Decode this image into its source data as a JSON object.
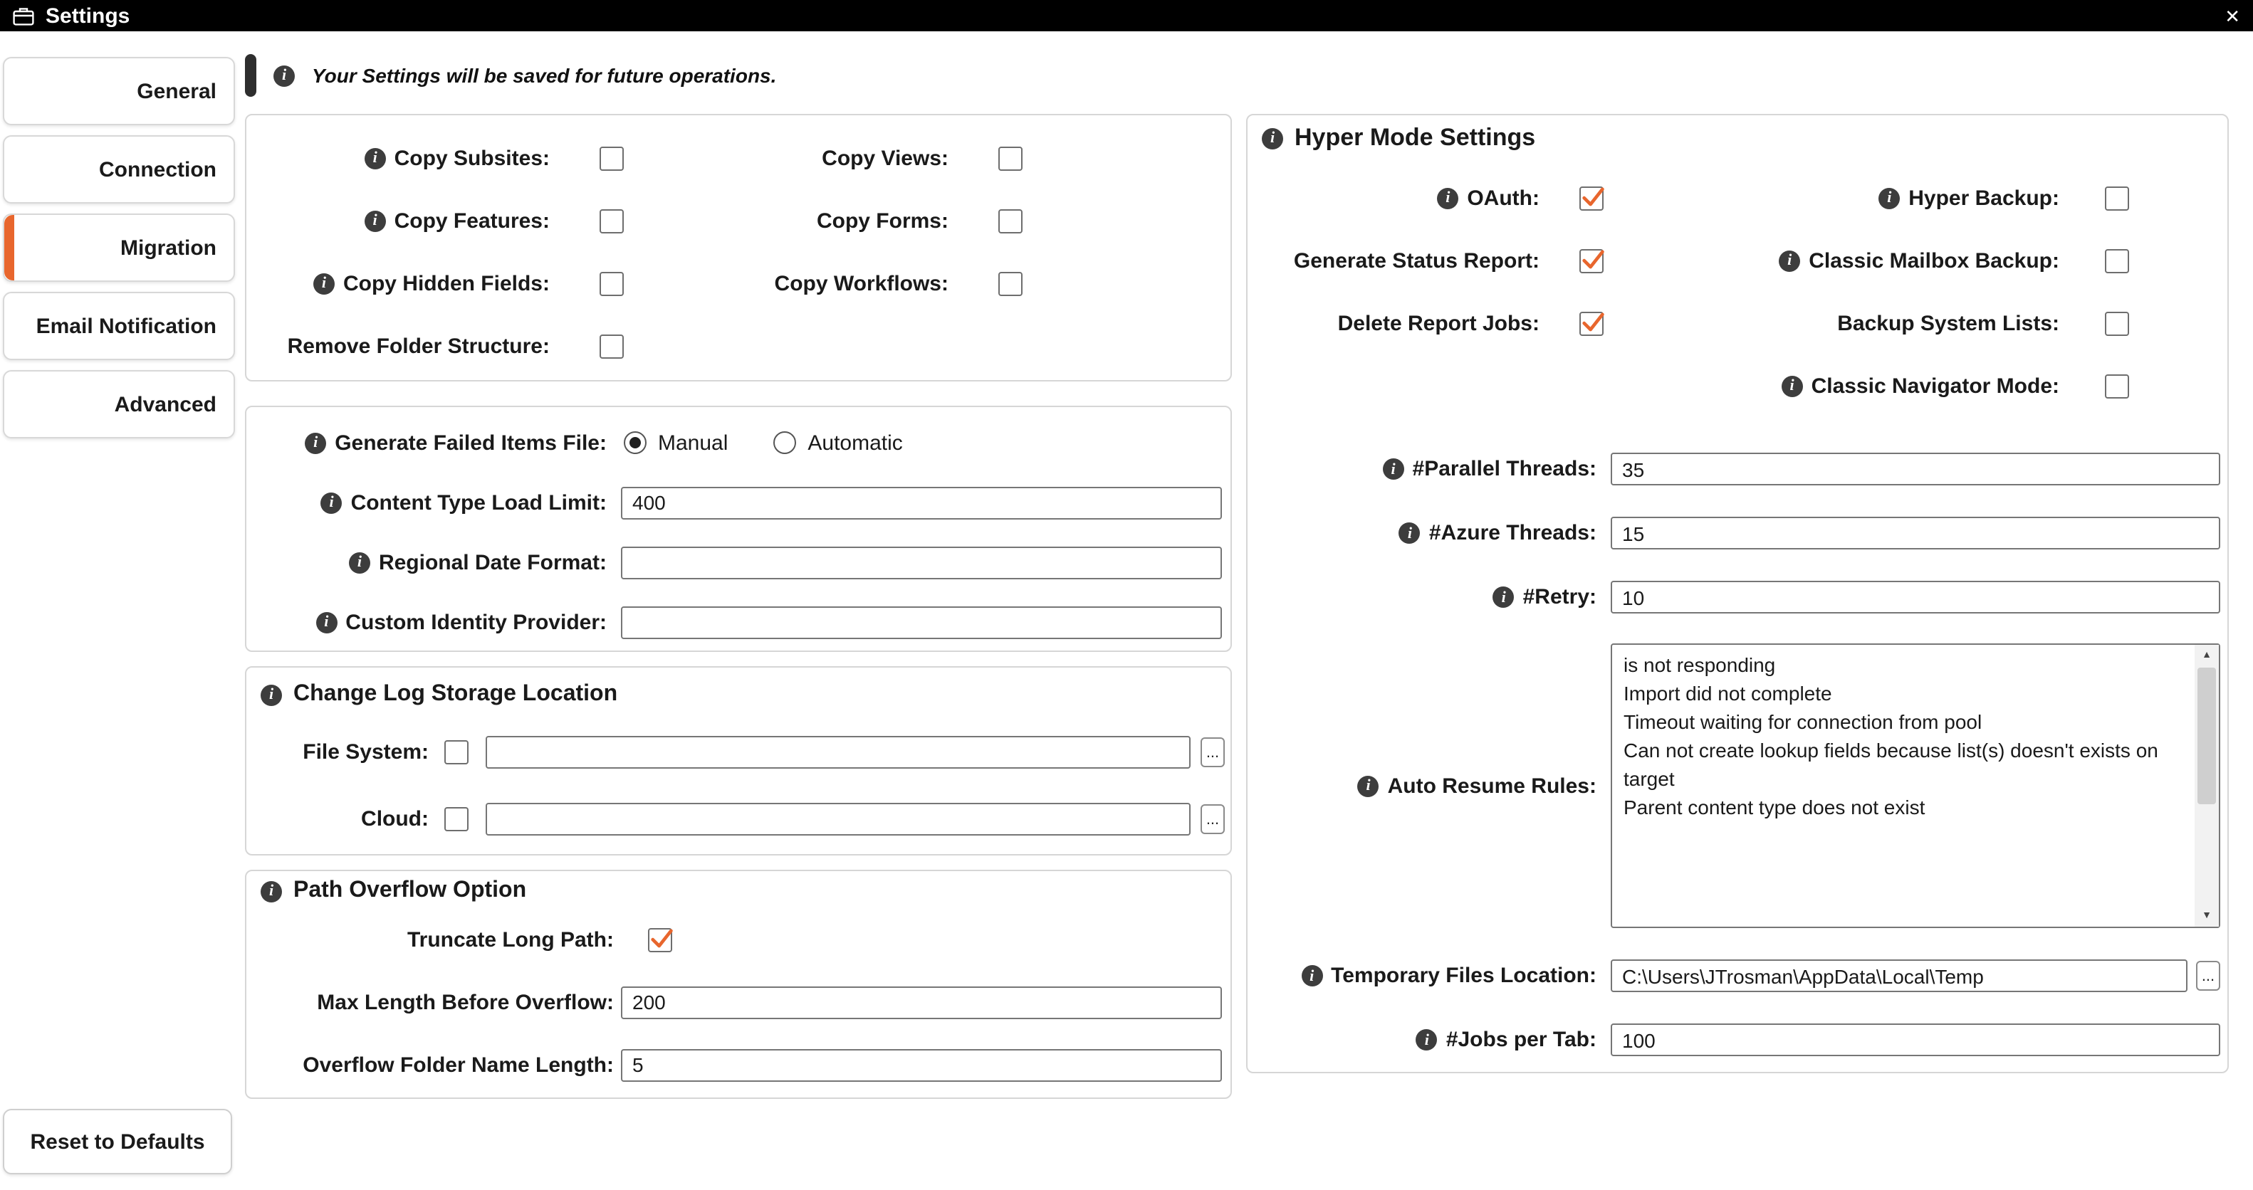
{
  "window": {
    "title": "Settings",
    "close_glyph": "✕"
  },
  "icons": {
    "info": "i",
    "browse": "...",
    "scroll_up": "▲",
    "scroll_down": "▼"
  },
  "colors": {
    "accent": "#E8662D",
    "titlebar": "#000000"
  },
  "sidebar": {
    "tabs": [
      {
        "label": "General",
        "active": false
      },
      {
        "label": "Connection",
        "active": false
      },
      {
        "label": "Migration",
        "active": true
      },
      {
        "label": "Email Notification",
        "active": false
      },
      {
        "label": "Advanced",
        "active": false
      }
    ],
    "reset_button": "Reset to Defaults"
  },
  "banner": {
    "text": "Your Settings will be saved for future operations."
  },
  "copy_options": {
    "items": [
      {
        "label": "Copy Subsites:",
        "info": true,
        "checked": false
      },
      {
        "label": "Copy Views:",
        "info": false,
        "checked": false
      },
      {
        "label": "Copy Features:",
        "info": true,
        "checked": false
      },
      {
        "label": "Copy Forms:",
        "info": false,
        "checked": false
      },
      {
        "label": "Copy Hidden Fields:",
        "info": true,
        "checked": false
      },
      {
        "label": "Copy Workflows:",
        "info": false,
        "checked": false
      },
      {
        "label": "Remove Folder Structure:",
        "info": false,
        "checked": false
      }
    ]
  },
  "failed_items": {
    "generate_label": "Generate Failed Items File:",
    "mode_options": [
      "Manual",
      "Automatic"
    ],
    "mode_selected": "Manual",
    "content_type_label": "Content Type Load Limit:",
    "content_type_value": "400",
    "regional_date_label": "Regional Date Format:",
    "regional_date_value": "",
    "identity_provider_label": "Custom Identity Provider:",
    "identity_provider_value": ""
  },
  "change_log": {
    "title": "Change Log Storage Location",
    "file_system_label": "File System:",
    "file_system_checked": false,
    "file_system_value": "",
    "cloud_label": "Cloud:",
    "cloud_checked": false,
    "cloud_value": ""
  },
  "path_overflow": {
    "title": "Path Overflow Option",
    "truncate_label": "Truncate Long Path:",
    "truncate_checked": true,
    "max_length_label": "Max Length Before Overflow:",
    "max_length_value": "200",
    "folder_name_label": "Overflow Folder Name Length:",
    "folder_name_value": "5"
  },
  "hyper_mode": {
    "title": "Hyper Mode Settings",
    "checkboxes": [
      {
        "label": "OAuth:",
        "info": true,
        "checked": true
      },
      {
        "label": "Hyper Backup:",
        "info": true,
        "checked": false
      },
      {
        "label": "Generate Status Report:",
        "info": false,
        "checked": true
      },
      {
        "label": "Classic Mailbox Backup:",
        "info": true,
        "checked": false
      },
      {
        "label": "Delete Report Jobs:",
        "info": false,
        "checked": true
      },
      {
        "label": "Backup System Lists:",
        "info": false,
        "checked": false
      },
      {
        "label": "Classic Navigator Mode:",
        "info": true,
        "checked": false
      }
    ],
    "parallel_threads_label": "#Parallel Threads:",
    "parallel_threads_value": "35",
    "azure_threads_label": "#Azure Threads:",
    "azure_threads_value": "15",
    "retry_label": "#Retry:",
    "retry_value": "10",
    "auto_resume_label": "Auto Resume Rules:",
    "auto_resume_value": "is not responding\nImport did not complete\nTimeout waiting for connection from pool\nCan not create lookup fields because list(s) doesn't exists on target\nParent content type does not exist",
    "temp_files_label": "Temporary Files Location:",
    "temp_files_value": "C:\\Users\\JTrosman\\AppData\\Local\\Temp",
    "jobs_per_tab_label": "#Jobs per Tab:",
    "jobs_per_tab_value": "100"
  }
}
